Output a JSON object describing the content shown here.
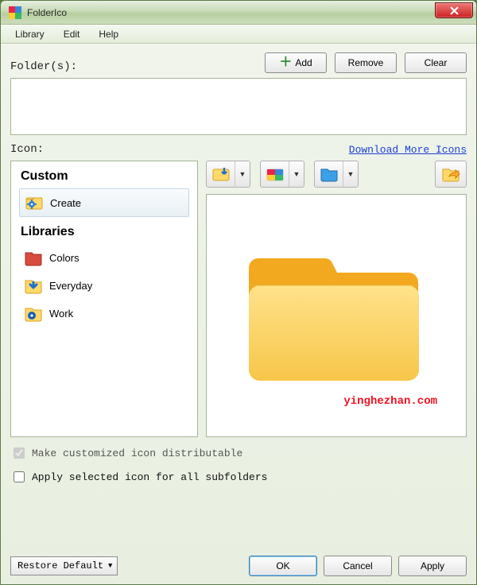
{
  "window": {
    "title": "FolderIco"
  },
  "menu": {
    "library": "Library",
    "edit": "Edit",
    "help": "Help"
  },
  "folders": {
    "label": "Folder(s):",
    "add": "Add",
    "remove": "Remove",
    "clear": "Clear"
  },
  "icon_section": {
    "label": "Icon:",
    "download_link": "Download More Icons"
  },
  "sidebar": {
    "custom_head": "Custom",
    "libraries_head": "Libraries",
    "items": {
      "create": "Create",
      "colors": "Colors",
      "everyday": "Everyday",
      "work": "Work"
    }
  },
  "checks": {
    "distributable": "Make customized icon distributable",
    "subfolders": "Apply selected icon for all subfolders"
  },
  "buttons": {
    "restore_default": "Restore Default",
    "ok": "OK",
    "cancel": "Cancel",
    "apply": "Apply"
  },
  "watermark": "yinghezhan.com"
}
